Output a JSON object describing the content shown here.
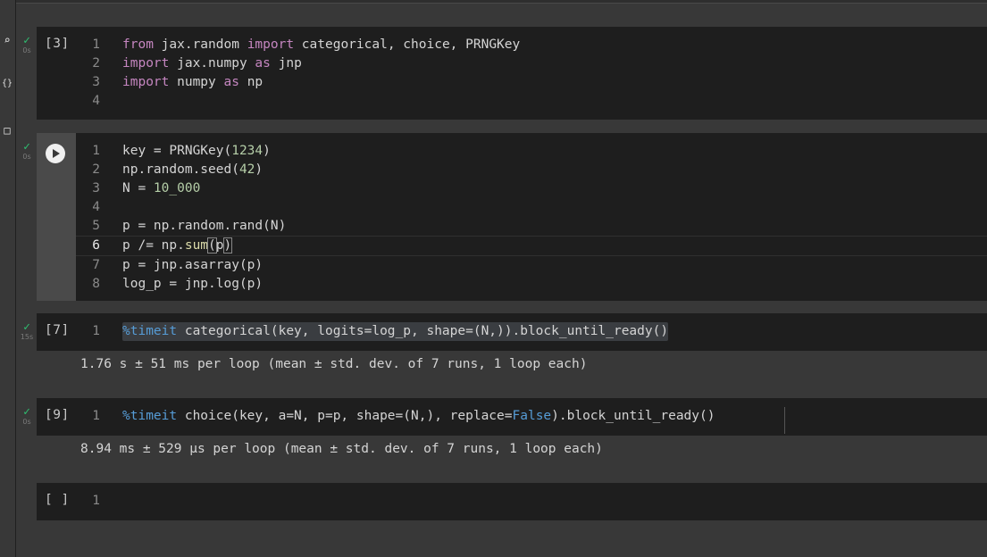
{
  "cells": [
    {
      "count": "[3]",
      "duration": "0s",
      "lines": [
        {
          "num": "1"
        },
        {
          "num": "2"
        },
        {
          "num": "3"
        },
        {
          "num": "4"
        }
      ],
      "code": {
        "l1": {
          "a": "from",
          "b": " jax.random ",
          "c": "import",
          "d": " categorical, choice, PRNGKey"
        },
        "l2": {
          "a": "import",
          "b": " jax.numpy ",
          "c": "as",
          "d": " jnp"
        },
        "l3": {
          "a": "import",
          "b": " numpy ",
          "c": "as",
          "d": " np"
        }
      }
    },
    {
      "duration": "0s",
      "run_label": "Run cell",
      "lines": [
        {
          "num": "1"
        },
        {
          "num": "2"
        },
        {
          "num": "3"
        },
        {
          "num": "4"
        },
        {
          "num": "5"
        },
        {
          "num": "6"
        },
        {
          "num": "7"
        },
        {
          "num": "8"
        }
      ],
      "code": {
        "l1": {
          "a": "key = PRNGKey(",
          "b": "1234",
          "c": ")"
        },
        "l2": {
          "a": "np.random.seed(",
          "b": "42",
          "c": ")"
        },
        "l3": {
          "a": "N = ",
          "b": "10_000"
        },
        "l5": {
          "a": "p = np.random.rand(N)"
        },
        "l6": {
          "a": "p /= np.",
          "b": "sum",
          "c": "(",
          "d": "p",
          "e": ")"
        },
        "l7": {
          "a": "p = jnp.asarray(p)"
        },
        "l8": {
          "a": "log_p = jnp.log(p)"
        }
      }
    },
    {
      "count": "[7]",
      "duration": "15s",
      "lines": [
        {
          "num": "1"
        }
      ],
      "code": {
        "magic": "%timeit",
        "rest": " categorical(key, logits=log_p, shape=(N,)).block_until_ready()"
      },
      "output": "1.76 s ± 51 ms per loop (mean ± std. dev. of 7 runs, 1 loop each)"
    },
    {
      "count": "[9]",
      "duration": "0s",
      "lines": [
        {
          "num": "1"
        }
      ],
      "code": {
        "magic": "%timeit",
        "a": " choice(key, a=N, p=p, shape=(N,), replace=",
        "const": "False",
        "b": ").block_until_ready()"
      },
      "output": "8.94 ms ± 529 µs per loop (mean ± std. dev. of 7 runs, 1 loop each)"
    },
    {
      "count": "[ ]",
      "lines": [
        {
          "num": "1"
        }
      ]
    }
  ],
  "leftbar": {
    "icons": [
      "search-icon",
      "variables-icon",
      "files-icon"
    ],
    "glyphs": {
      "search": "⌕",
      "variables": "{}",
      "files": "□"
    }
  },
  "colors": {
    "background": "#383838",
    "cell": "#1e1e1e",
    "check": "#2fbf71",
    "keyword": "#c586c0",
    "number": "#b5cea8",
    "function": "#dcdcaa",
    "magic": "#569cd6"
  }
}
